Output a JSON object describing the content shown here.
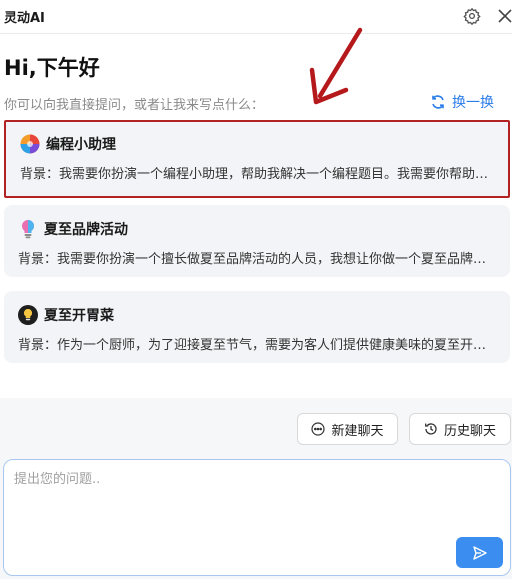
{
  "app": {
    "title": "灵动AI"
  },
  "header": {
    "greeting": "Hi,下午好",
    "subtitle": "你可以向我直接提问，或者让我来写点什么：",
    "refresh_label": "换一换"
  },
  "cards": [
    {
      "title": "编程小助理",
      "desc": "背景：我需要你扮演一个编程小助理，帮助我解决一个编程题目。我需要你帮助我完成题目的解答",
      "icon": "colorful-ball-icon",
      "highlighted": true
    },
    {
      "title": "夏至品牌活动",
      "desc": "背景：我需要你扮演一个擅长做夏至品牌活动的人员，我想让你做一个夏至品牌活动方案",
      "icon": "lightbulb-icon"
    },
    {
      "title": "夏至开胃菜",
      "desc": "背景：作为一个厨师，为了迎接夏至节气，需要为客人们提供健康美味的夏至开胃菜",
      "icon": "bulb-dark-icon"
    }
  ],
  "actions": {
    "new_chat": "新建聊天",
    "history_chat": "历史聊天"
  },
  "input": {
    "placeholder": "提出您的问题.."
  },
  "colors": {
    "accent": "#2b7de9",
    "highlight": "#b22222",
    "send": "#3b8ef0"
  }
}
